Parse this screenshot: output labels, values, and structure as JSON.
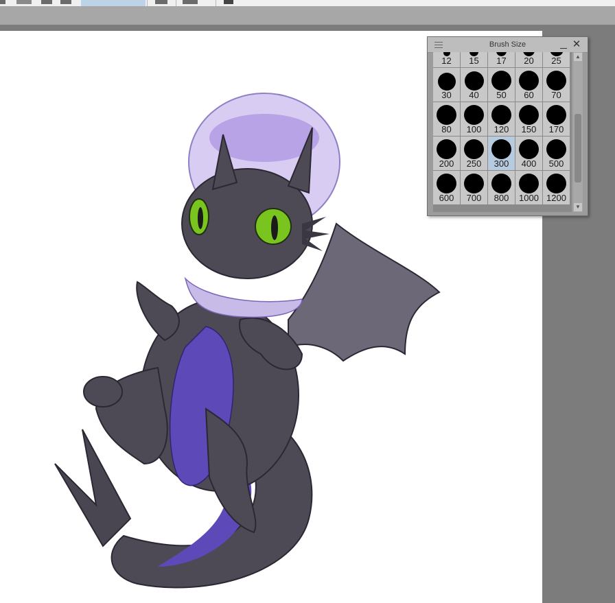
{
  "palette": {
    "title": "Brush Size",
    "menu_icon": "hamburger-icon",
    "minimize_icon": "minimize-icon",
    "close_icon": "close-icon",
    "selected_size": "300",
    "sizes": [
      "12",
      "15",
      "17",
      "20",
      "25",
      "30",
      "40",
      "50",
      "60",
      "70",
      "80",
      "100",
      "120",
      "150",
      "170",
      "200",
      "250",
      "300",
      "400",
      "500",
      "600",
      "700",
      "800",
      "1000",
      "1200"
    ]
  },
  "colors": {
    "workspace": "#7c7c7c",
    "canvas": "#ffffff",
    "palette_bg": "#9c9c9c",
    "cell_bg": "#c8c8c8",
    "cell_selected": "#b7cbe0"
  }
}
